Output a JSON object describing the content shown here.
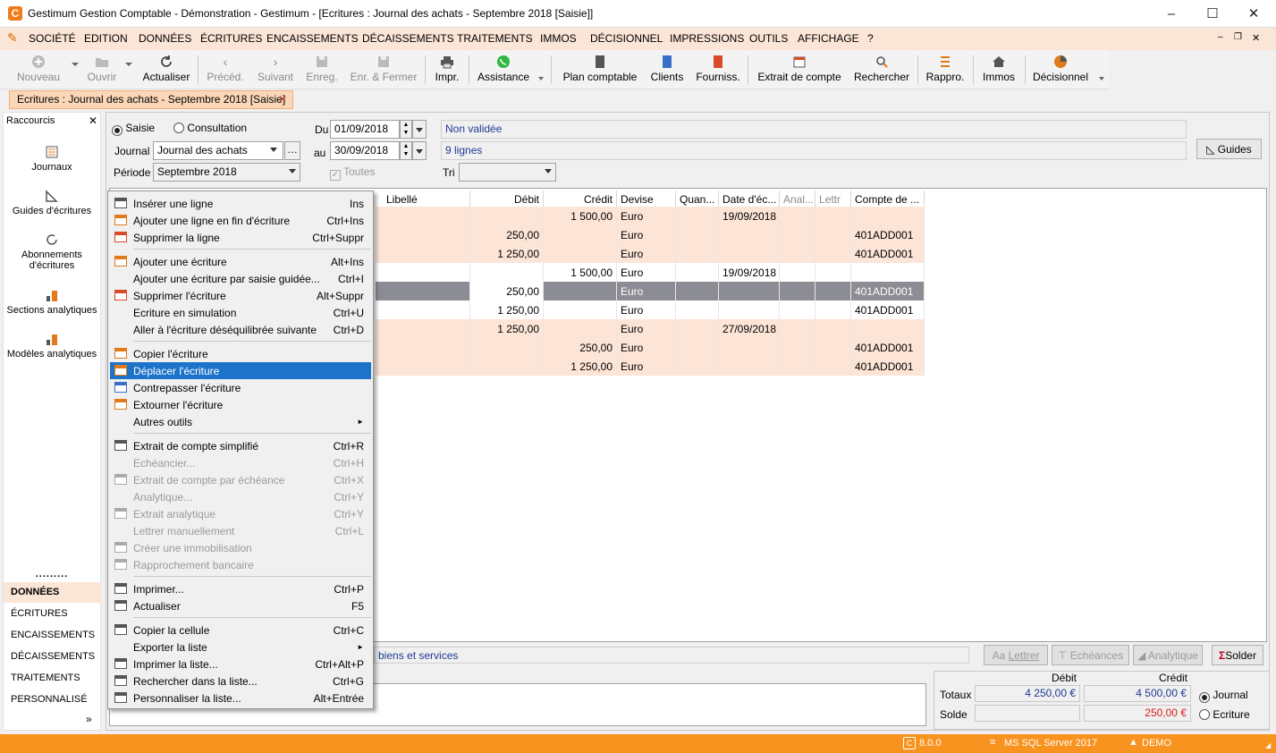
{
  "window": {
    "title": "Gestimum Gestion Comptable - Démonstration - Gestimum - [Ecritures : Journal des achats - Septembre 2018 [Saisie]]",
    "icon": "C"
  },
  "menu": [
    "SOCIÉTÉ",
    "EDITION",
    "DONNÉES",
    "ÉCRITURES",
    "ENCAISSEMENTS",
    "DÉCAISSEMENTS",
    "TRAITEMENTS",
    "IMMOS",
    "DÉCISIONNEL",
    "IMPRESSIONS",
    "OUTILS",
    "AFFICHAGE",
    "?"
  ],
  "toolbar": {
    "nouveau": "Nouveau",
    "ouvrir": "Ouvrir",
    "actualiser": "Actualiser",
    "preced": "Précéd.",
    "suivant": "Suivant",
    "enreg": "Enreg.",
    "enreg_fermer": "Enr. & Fermer",
    "impr": "Impr.",
    "assistance": "Assistance",
    "plan": "Plan comptable",
    "clients": "Clients",
    "fourniss": "Fourniss.",
    "extrait": "Extrait de compte",
    "rechercher": "Rechercher",
    "rappro": "Rappro.",
    "immos": "Immos",
    "decisionnel": "Décisionnel"
  },
  "doc_tab": "Ecritures : Journal des achats - Septembre 2018 [Saisie]",
  "sidebar": {
    "title": "Raccourcis",
    "items": [
      "Journaux",
      "Guides d'écritures",
      "Abonnements d'écritures",
      "Sections analytiques",
      "Modèles analytiques"
    ],
    "dots": ".........",
    "nav": [
      "DONNÉES",
      "ÉCRITURES",
      "ENCAISSEMENTS",
      "DÉCAISSEMENTS",
      "TRAITEMENTS",
      "PERSONNALISÉ"
    ],
    "more": "»"
  },
  "form": {
    "saisie": "Saisie",
    "consultation": "Consultation",
    "du_label": "Du",
    "du": "01/09/2018",
    "au_label": "au",
    "au": "30/09/2018",
    "journal_label": "Journal",
    "journal": "Journal des achats",
    "periode_label": "Période",
    "periode": "Septembre 2018",
    "toutes": "Toutes",
    "tri_label": "Tri",
    "status": "Non validée",
    "lignes": "9 lignes",
    "guides": "Guides"
  },
  "grid": {
    "headers": [
      "Libellé",
      "Débit",
      "Crédit",
      "Devise",
      "Quan...",
      "Date d'éc...",
      "Anal...",
      "Lettr",
      "Compte de ..."
    ],
    "rows": [
      {
        "debit": "",
        "credit": "1 500,00",
        "devise": "Euro",
        "date": "19/09/2018",
        "compte": ""
      },
      {
        "debit": "250,00",
        "credit": "",
        "devise": "Euro",
        "date": "",
        "compte": "401ADD001"
      },
      {
        "debit": "1 250,00",
        "credit": "",
        "devise": "Euro",
        "date": "",
        "compte": "401ADD001"
      },
      {
        "debit": "",
        "credit": "1 500,00",
        "devise": "Euro",
        "date": "19/09/2018",
        "compte": ""
      },
      {
        "debit": "250,00",
        "credit": "",
        "devise": "Euro",
        "date": "",
        "compte": "401ADD001"
      },
      {
        "debit": "1 250,00",
        "credit": "",
        "devise": "Euro",
        "date": "",
        "compte": "401ADD001"
      },
      {
        "debit": "1 250,00",
        "credit": "",
        "devise": "Euro",
        "date": "27/09/2018",
        "compte": ""
      },
      {
        "debit": "",
        "credit": "250,00",
        "devise": "Euro",
        "date": "",
        "compte": "401ADD001"
      },
      {
        "debit": "",
        "credit": "1 250,00",
        "devise": "Euro",
        "date": "",
        "compte": "401ADD001"
      }
    ]
  },
  "account_desc": "biens et services",
  "actions": {
    "lettrer": "Lettrer",
    "echeances": "Echéances",
    "analytique": "Analytique",
    "solder": "Solder"
  },
  "totals": {
    "debit_h": "Débit",
    "credit_h": "Crédit",
    "totaux": "Totaux",
    "solde": "Solde",
    "tot_debit": "4 250,00 €",
    "tot_credit": "4 500,00 €",
    "solde_credit": "250,00 €",
    "journal": "Journal",
    "ecriture": "Ecriture"
  },
  "context_menu": [
    {
      "t": "Insérer une ligne",
      "k": "Ins",
      "icon": "insert-line-icon"
    },
    {
      "t": "Ajouter une ligne en fin d'écriture",
      "k": "Ctrl+Ins",
      "icon": "add-line-icon"
    },
    {
      "t": "Supprimer la ligne",
      "k": "Ctrl+Suppr",
      "icon": "delete-line-icon"
    },
    {
      "sep": true
    },
    {
      "t": "Ajouter une écriture",
      "k": "Alt+Ins",
      "icon": "add-entry-icon"
    },
    {
      "t": "Ajouter une écriture par saisie guidée...",
      "k": "Ctrl+I"
    },
    {
      "t": "Supprimer l'écriture",
      "k": "Alt+Suppr",
      "icon": "delete-entry-icon"
    },
    {
      "t": "Ecriture en simulation",
      "k": "Ctrl+U"
    },
    {
      "t": "Aller à l'écriture déséquilibrée suivante",
      "k": "Ctrl+D"
    },
    {
      "sep": true
    },
    {
      "t": "Copier l'écriture",
      "k": "",
      "icon": "copy-entry-icon"
    },
    {
      "t": "Déplacer l'écriture",
      "k": "",
      "icon": "move-entry-icon",
      "sel": true
    },
    {
      "t": "Contrepasser l'écriture",
      "k": "",
      "icon": "reverse-entry-icon"
    },
    {
      "t": "Extourner l'écriture",
      "k": "",
      "icon": "extourne-icon"
    },
    {
      "t": "Autres outils",
      "k": "►"
    },
    {
      "sep": true
    },
    {
      "t": "Extrait de compte simplifié",
      "k": "Ctrl+R",
      "icon": "account-extract-icon"
    },
    {
      "t": "Echéancier...",
      "k": "Ctrl+H",
      "dis": true
    },
    {
      "t": "Extrait de compte par échéance",
      "k": "Ctrl+X",
      "dis": true,
      "icon": "account-due-icon"
    },
    {
      "t": "Analytique...",
      "k": "Ctrl+Y",
      "dis": true
    },
    {
      "t": "Extrait analytique",
      "k": "Ctrl+Y",
      "dis": true,
      "icon": "analytic-extract-icon"
    },
    {
      "t": "Lettrer manuellement",
      "k": "Ctrl+L",
      "dis": true
    },
    {
      "t": "Créer une immobilisation",
      "k": "",
      "dis": true,
      "icon": "home-icon"
    },
    {
      "t": "Rapprochement bancaire",
      "k": "",
      "dis": true,
      "icon": "bank-icon"
    },
    {
      "sep": true
    },
    {
      "t": "Imprimer...",
      "k": "Ctrl+P",
      "icon": "print-icon"
    },
    {
      "t": "Actualiser",
      "k": "F5",
      "icon": "refresh-icon"
    },
    {
      "sep": true
    },
    {
      "t": "Copier la cellule",
      "k": "Ctrl+C",
      "icon": "copy-icon"
    },
    {
      "t": "Exporter la liste",
      "k": "►"
    },
    {
      "t": "Imprimer la liste...",
      "k": "Ctrl+Alt+P",
      "icon": "print-list-icon"
    },
    {
      "t": "Rechercher dans la liste...",
      "k": "Ctrl+G",
      "icon": "search-list-icon"
    },
    {
      "t": "Personnaliser la liste...",
      "k": "Alt+Entrée",
      "icon": "customize-list-icon"
    }
  ],
  "statusbar": {
    "version": "8.0.0",
    "db": "MS SQL Server 2017",
    "user": "DEMO"
  }
}
